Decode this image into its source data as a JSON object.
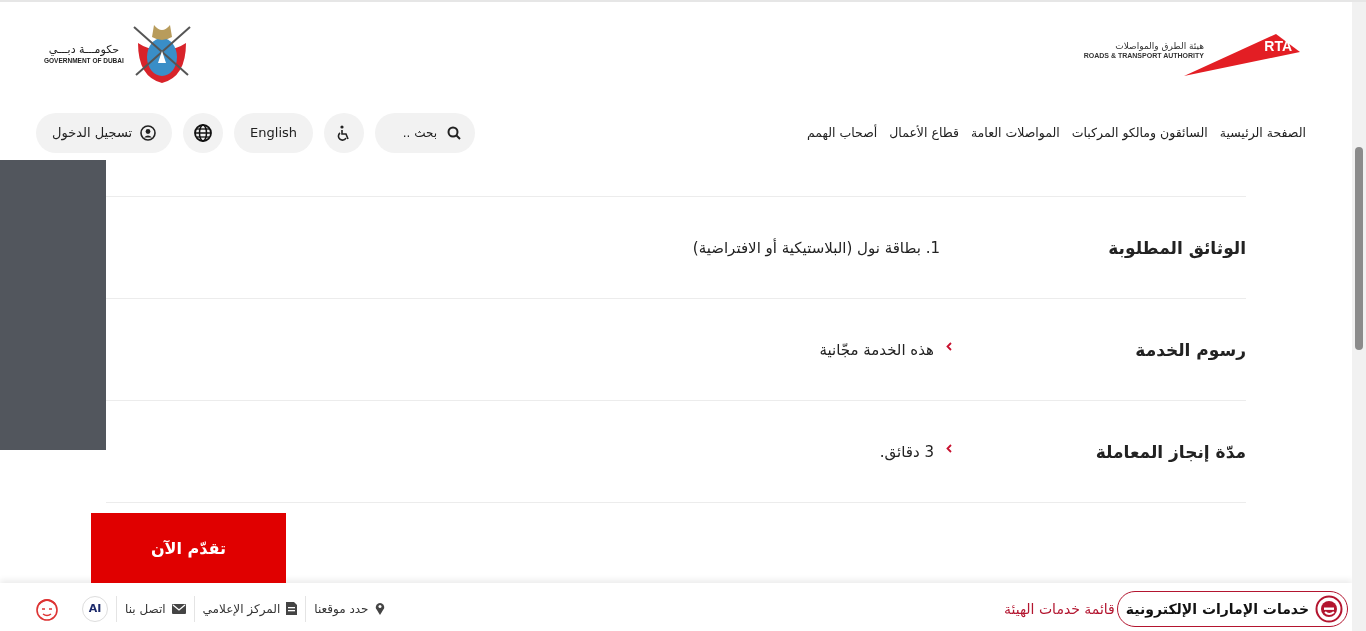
{
  "header": {
    "government_logo": {
      "arabic": "حكومـــة دبـــي",
      "english": "GOVERNMENT OF DUBAI"
    },
    "rta_logo": {
      "mark": "RTA",
      "arabic": "هيئة الطرق والمواصلات",
      "english": "ROADS & TRANSPORT AUTHORITY"
    }
  },
  "nav": {
    "items": [
      "الصفحة الرئيسية",
      "السائقون ومالكو المركبات",
      "المواصلات العامة",
      "قطاع الأعمال",
      "أصحاب الهمم"
    ],
    "search": {
      "placeholder": "بحث .."
    },
    "language": "English",
    "login": "تسجيل الدخول"
  },
  "details": [
    {
      "label": "الوثائق المطلوبة",
      "value": "1. بطاقة نول (البلاستيكية أو الافتراضية)",
      "kind": "plain"
    },
    {
      "label": "رسوم الخدمة",
      "value": "هذه الخدمة مجّانية",
      "kind": "bullet"
    },
    {
      "label": "مدّة إنجاز المعاملة",
      "value": "3 دقائق.",
      "kind": "bullet"
    }
  ],
  "apply_button": "تقدّم الآن",
  "footer": {
    "eservices": "خدمات الإمارات الإلكترونية",
    "services_list": "قائمة خدمات الهيئة",
    "links": [
      {
        "label": "حدد موقعنا",
        "kind": "pin"
      },
      {
        "label": "المركز الإعلامي",
        "kind": "doc"
      },
      {
        "label": "اتصل بنا",
        "kind": "mail"
      }
    ],
    "ai": "AI"
  }
}
